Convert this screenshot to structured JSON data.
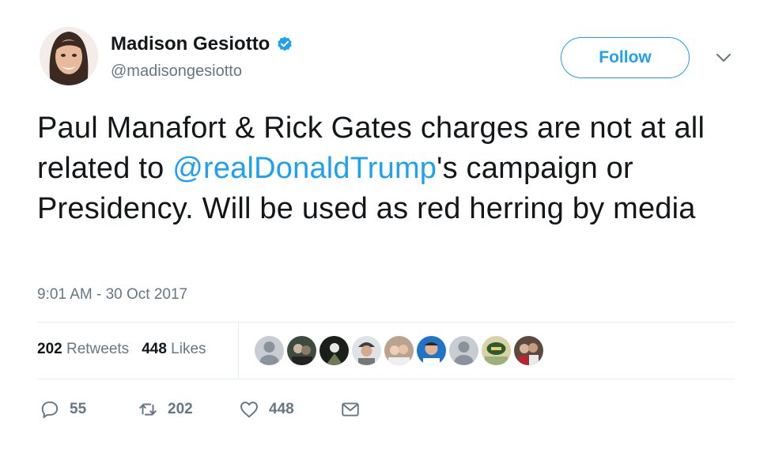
{
  "tweet": {
    "author": {
      "name": "Madison Gesiotto",
      "handle": "@madisongesiotto",
      "verified": true
    },
    "follow_label": "Follow",
    "text_before": "Paul Manafort & Rick Gates charges are not at all related to ",
    "mention": "@realDonaldTrump",
    "text_after": "'s campaign or Presidency. Will be used as red herring by media",
    "timestamp": "9:01 AM - 30 Oct 2017",
    "stats": {
      "retweets_count": "202",
      "retweets_label": "Retweets",
      "likes_count": "448",
      "likes_label": "Likes"
    },
    "actions": {
      "replies": "55",
      "retweets": "202",
      "likes": "448"
    }
  },
  "colors": {
    "accent": "#1da1f2",
    "secondary_text": "#657786",
    "primary_text": "#14171a",
    "divider": "#e6ecf0"
  },
  "icons": [
    "verified-badge-icon",
    "chevron-down-icon",
    "reply-icon",
    "retweet-icon",
    "heart-icon",
    "envelope-icon"
  ]
}
